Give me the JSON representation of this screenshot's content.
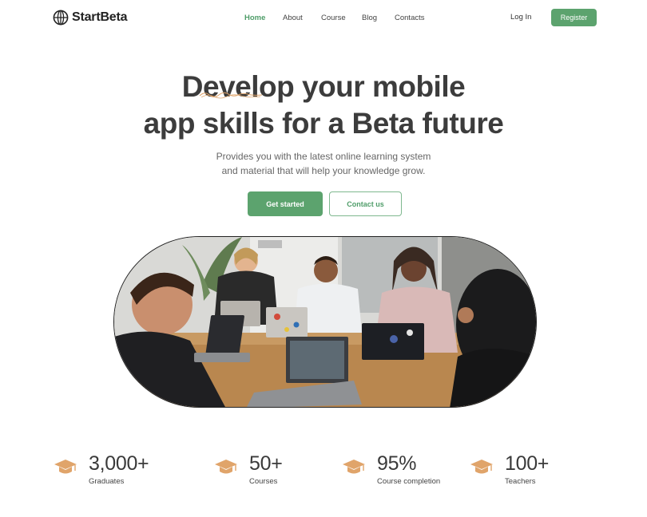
{
  "brand": {
    "name": "StartBeta",
    "accent": "#5ca36e"
  },
  "nav": {
    "links": [
      "Home",
      "About",
      "Course",
      "Blog",
      "Contacts"
    ],
    "active": "Home",
    "login_label": "Log In",
    "register_label": "Register"
  },
  "hero": {
    "title_line1": "Develop your mobile",
    "title_line2": "app skills for a Beta future",
    "subtitle_line1": "Provides you with the latest online learning system",
    "subtitle_line2": "and material that will help your knowledge grow.",
    "primary_cta": "Get started",
    "secondary_cta": "Contact us"
  },
  "stats": [
    {
      "icon": "graduation-cap-icon",
      "value": "3,000+",
      "label": "Graduates"
    },
    {
      "icon": "graduation-cap-icon",
      "value": "50+",
      "label": "Courses"
    },
    {
      "icon": "graduation-cap-icon",
      "value": "95%",
      "label": "Course completion"
    },
    {
      "icon": "graduation-cap-icon",
      "value": "100+",
      "label": "Teachers"
    }
  ],
  "colors": {
    "stat_icon": "#e0a46a",
    "heading": "#3c3c3c"
  }
}
